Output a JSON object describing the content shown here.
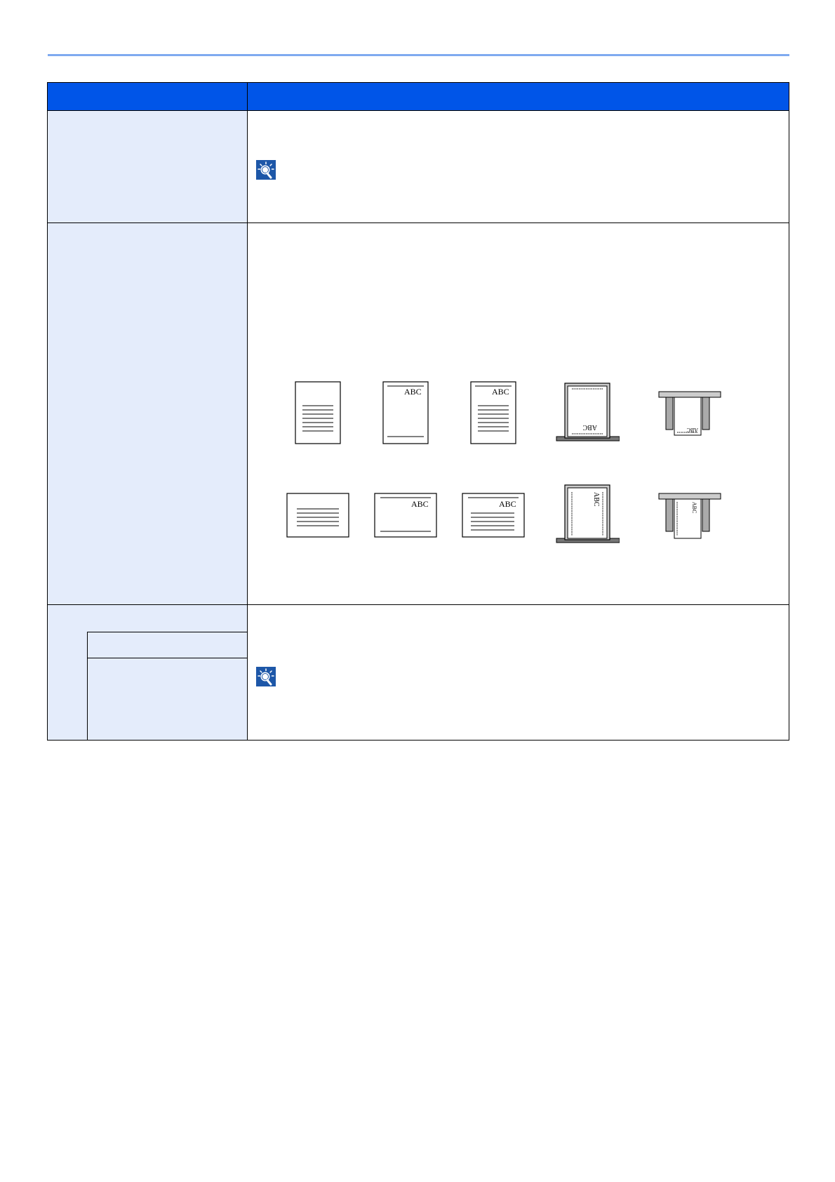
{
  "header": {
    "left_label": "",
    "right_label": ""
  },
  "figures": {
    "sample_text": "ABC",
    "rotated_text": "ABC"
  },
  "colors": {
    "header_blue": "#0055e8",
    "left_cell_blue": "#e4ecfb",
    "rule_blue": "#7faaf0",
    "icon_blue": "#1d57a8"
  },
  "icons": [
    "hint-icon",
    "hint-icon"
  ]
}
